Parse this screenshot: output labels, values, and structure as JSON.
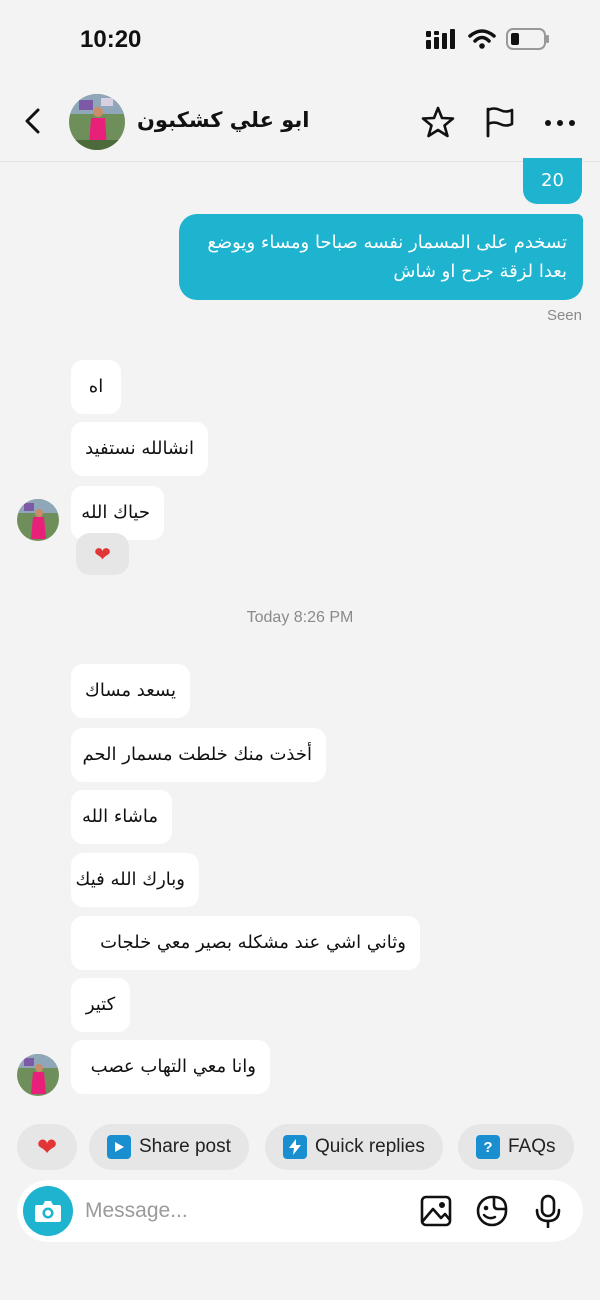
{
  "status_bar": {
    "time": "10:20"
  },
  "header": {
    "contact_name": "ابو علي كشكبون",
    "icons": [
      "back-icon",
      "star-icon",
      "flag-icon",
      "more-icon"
    ]
  },
  "messages": {
    "out": [
      "20",
      "تسخدم على المسمار نفسه صباحا ومساء ويوضع",
      "بعدا لزقة جرح او شاش"
    ],
    "seen": "Seen",
    "group1": [
      "اه",
      "انشالله نستفيد",
      "حياك الله"
    ],
    "reaction": "❤",
    "date": "Today 8:26 PM",
    "group2": [
      "يسعد مساك",
      "أخذت منك خلطت مسمار الحم",
      "ماشاء الله",
      "وبارك الله فيك",
      "وثاني اشي عند مشكله بصير معي خلجات",
      "كتير",
      "وانا معي التهاب عصب"
    ]
  },
  "quick_actions": {
    "heart": "❤",
    "share_post": "Share post",
    "quick_replies": "Quick replies",
    "faqs": "FAQs",
    "faqs_glyph": "?"
  },
  "composer": {
    "placeholder": "Message..."
  },
  "colors": {
    "accent": "#1eb3cf",
    "chip_icon": "#1a8fcf",
    "heart": "#e23636"
  }
}
